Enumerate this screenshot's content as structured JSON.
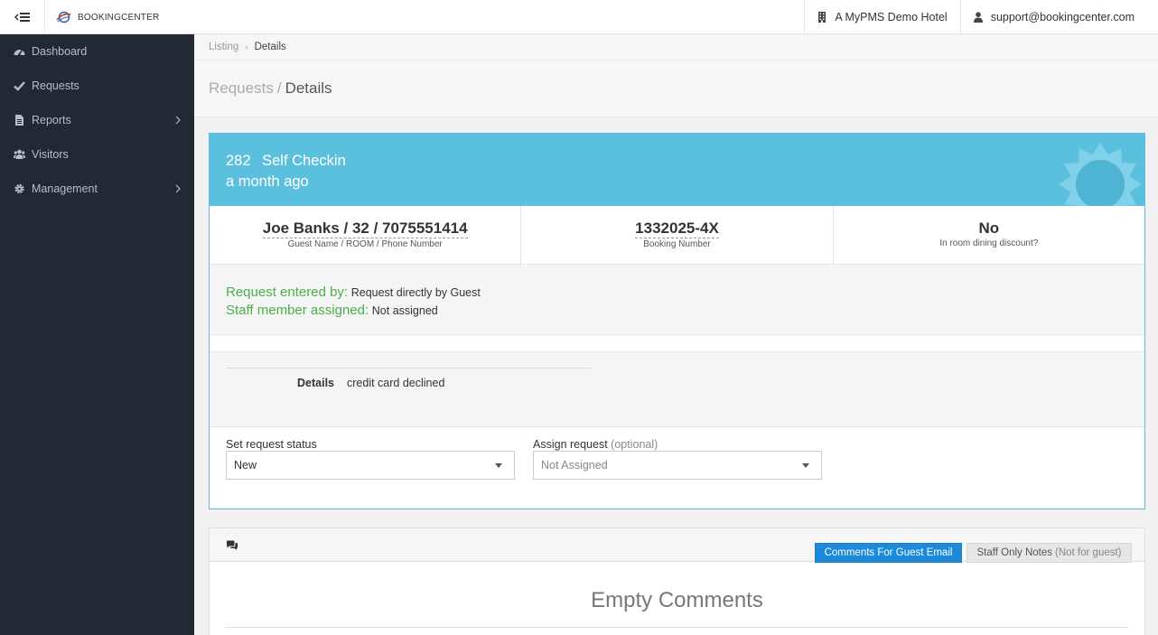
{
  "header": {
    "brand": "BOOKINGCENTER",
    "hotel": "A MyPMS Demo Hotel",
    "user_email": "support@bookingcenter.com",
    "icons": {
      "toggle": "bars-left-icon",
      "hotel": "building-icon",
      "user": "user-icon"
    }
  },
  "sidebar": {
    "items": [
      {
        "label": "Dashboard",
        "icon": "tachometer-icon",
        "has_submenu": false
      },
      {
        "label": "Requests",
        "icon": "check-icon",
        "has_submenu": false
      },
      {
        "label": "Reports",
        "icon": "file-icon",
        "has_submenu": true
      },
      {
        "label": "Visitors",
        "icon": "users-icon",
        "has_submenu": false
      },
      {
        "label": "Management",
        "icon": "gear-icon",
        "has_submenu": true
      }
    ]
  },
  "breadcrumb": {
    "parent": "Listing",
    "current": "Details"
  },
  "page_header": {
    "section": "Requests",
    "title": "Details"
  },
  "request": {
    "id": "282",
    "type": "Self Checkin",
    "time_ago": "a month ago",
    "guest": {
      "value": "Joe Banks / 32 / 7075551414",
      "label": "Guest Name / ROOM / Phone Number"
    },
    "booking": {
      "value": "1332025-4X",
      "label": "Booking Number"
    },
    "dining": {
      "value": "No",
      "label": "In room dining discount?"
    },
    "entered_by_label": "Request entered by:",
    "entered_by_value": "Request directly by Guest",
    "assigned_label": "Staff member assigned:",
    "assigned_value": "Not assigned",
    "details_label": "Details",
    "details_value": "credit card declined"
  },
  "form": {
    "status_label": "Set request status",
    "status_value": "New",
    "assign_label": "Assign request",
    "assign_optional": "(optional)",
    "assign_value": "Not Assigned"
  },
  "comments": {
    "tab_guest": "Comments For Guest Email",
    "tab_staff": "Staff Only Notes",
    "tab_staff_note": "(Not for guest)",
    "empty_text": "Empty Comments"
  },
  "colors": {
    "sidebar_bg": "#222933",
    "card_header": "#5bc0de",
    "accent_green": "#4cae4c",
    "tab_active": "#1c8ad8"
  }
}
